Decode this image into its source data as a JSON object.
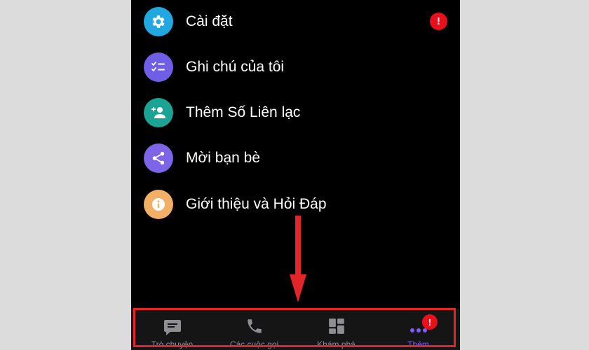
{
  "colors": {
    "settings_icon": "#21a8e0",
    "notes_icon": "#6f5ee6",
    "add_contact_icon": "#1ba394",
    "invite_icon": "#7e64e6",
    "about_icon": "#f2b066",
    "alert": "#e8111b",
    "active_tab": "#7d5dff",
    "highlight": "#e3252a"
  },
  "menu": {
    "items": [
      {
        "label": "Cài đặt",
        "icon": "gear-icon",
        "badge": "!"
      },
      {
        "label": "Ghi chú của tôi",
        "icon": "checklist-icon"
      },
      {
        "label": "Thêm Số Liên lạc",
        "icon": "add-person-icon"
      },
      {
        "label": "Mời bạn bè",
        "icon": "share-icon"
      },
      {
        "label": "Giới thiệu và Hỏi Đáp",
        "icon": "info-icon"
      }
    ]
  },
  "tabbar": {
    "tabs": [
      {
        "label": "Trò chuyện",
        "icon": "chat-bubble-icon"
      },
      {
        "label": "Các cuộc gọi",
        "icon": "phone-icon"
      },
      {
        "label": "Khám phá",
        "icon": "grid-icon"
      },
      {
        "label": "Thêm",
        "icon": "more-dots-icon",
        "badge": "!",
        "active": true
      }
    ]
  }
}
